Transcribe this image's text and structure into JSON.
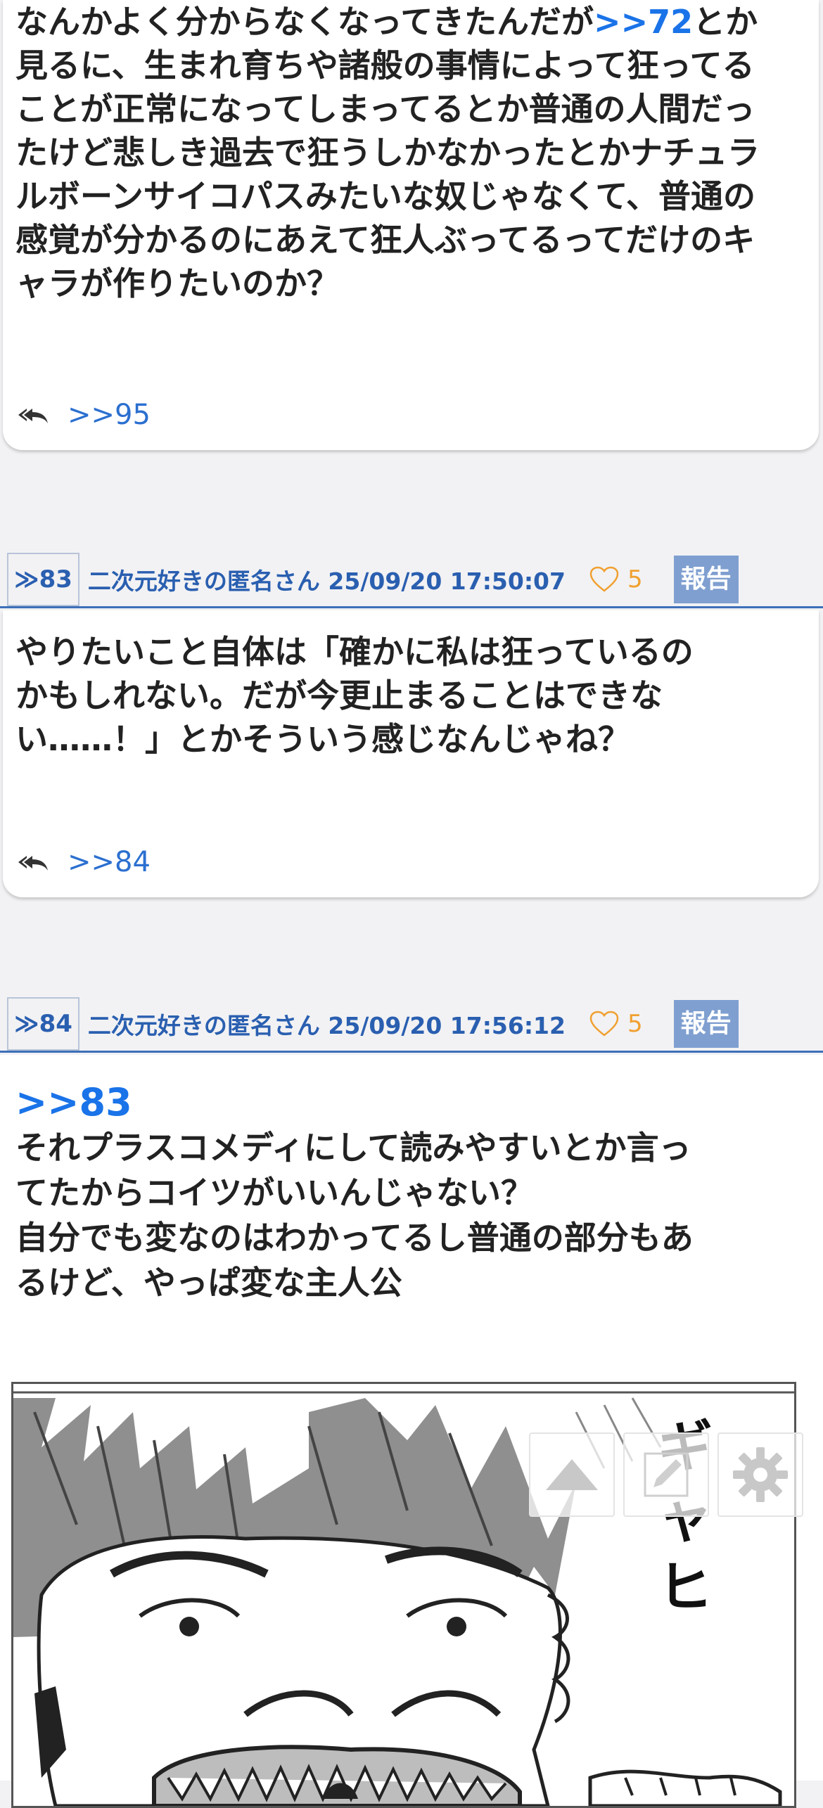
{
  "post_top": {
    "lines": [
      {
        "pre": "なんかよく分からなくなってきたんだが",
        "anchor": ">>72",
        "post": "とか"
      },
      {
        "text": "見るに、生まれ育ちや諸般の事情によって狂ってる"
      },
      {
        "text": "ことが正常になってしまってるとか普通の人間だっ"
      },
      {
        "text": "たけど悲しき過去で狂うしかなかったとかナチュラ"
      },
      {
        "text": "ルボーンサイコパスみたいな奴じゃなくて、普通の"
      },
      {
        "text": "感覚が分かるのにあえて狂人ぶってるってだけのキ"
      },
      {
        "text": "ャラが作りたいのか？"
      }
    ],
    "reply_link": ">>95",
    "reply_icon": "reply-all-icon"
  },
  "post_83": {
    "number": "≫83",
    "author": "二次元好きの匿名さん",
    "datetime": "25/09/20 17:50:07",
    "likes": "5",
    "report_label": "報告",
    "body_lines": [
      "やりたいこと自体は「確かに私は狂っているの",
      "かもしれない。だが今更止まることはできな",
      "い……！」とかそういう感じなんじゃね？"
    ],
    "reply_link": ">>84"
  },
  "post_84": {
    "number": "≫84",
    "author": "二次元好きの匿名さん",
    "datetime": "25/09/20 17:56:12",
    "likes": "5",
    "report_label": "報告",
    "anchor": ">>83",
    "body_lines": [
      "それプラスコメディにして読みやすいとか言っ",
      "てたからコイツがいいんじゃない？",
      "自分でも変なのはわかってるし普通の部分もあ",
      "るけど、やっぱ変な主人公"
    ],
    "image_sfx": "ギャヒ"
  },
  "controls": {
    "icons": [
      "scroll-top-icon",
      "edit-icon",
      "gear-icon"
    ]
  },
  "colors": {
    "link_blue": "#1a73e8",
    "header_blue": "#2a5fb0",
    "like_orange": "#f0a030",
    "report_bg": "#7f9fd0"
  }
}
